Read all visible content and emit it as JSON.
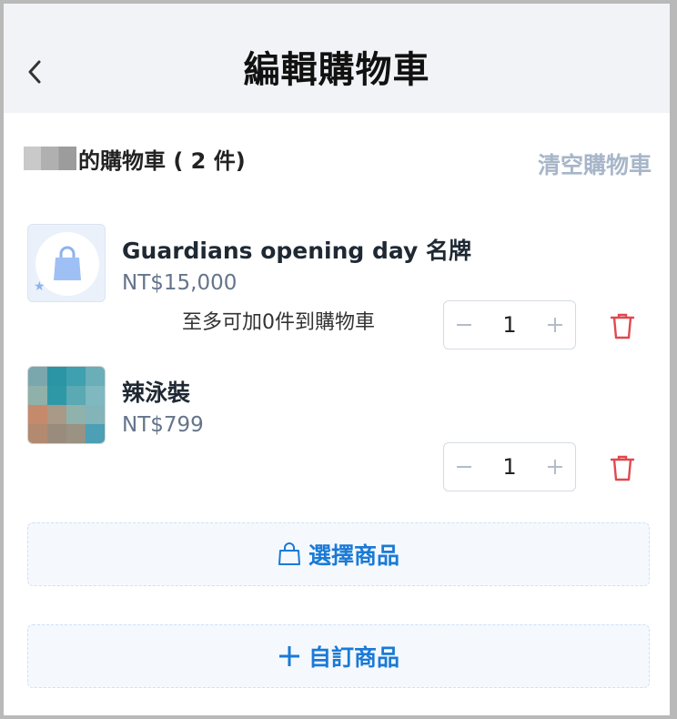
{
  "header": {
    "title": "編輯購物車"
  },
  "cart": {
    "title": "的購物車 ( 2 件)",
    "clear_label": "清空購物車"
  },
  "items": [
    {
      "name": "Guardians opening day 名牌",
      "price": "NT$15,000",
      "limit_note": "至多可加0件到購物車",
      "quantity": "1",
      "icon": "shopping-bag-icon"
    },
    {
      "name": "辣泳裝",
      "price": "NT$799",
      "quantity": "1"
    }
  ],
  "actions": {
    "select_products": "選擇商品",
    "custom_product": "自訂商品"
  },
  "colors": {
    "accent": "#1a7ad6",
    "delete": "#e0484f",
    "muted": "#a7b6c8",
    "header_bg": "#f2f3f7"
  }
}
